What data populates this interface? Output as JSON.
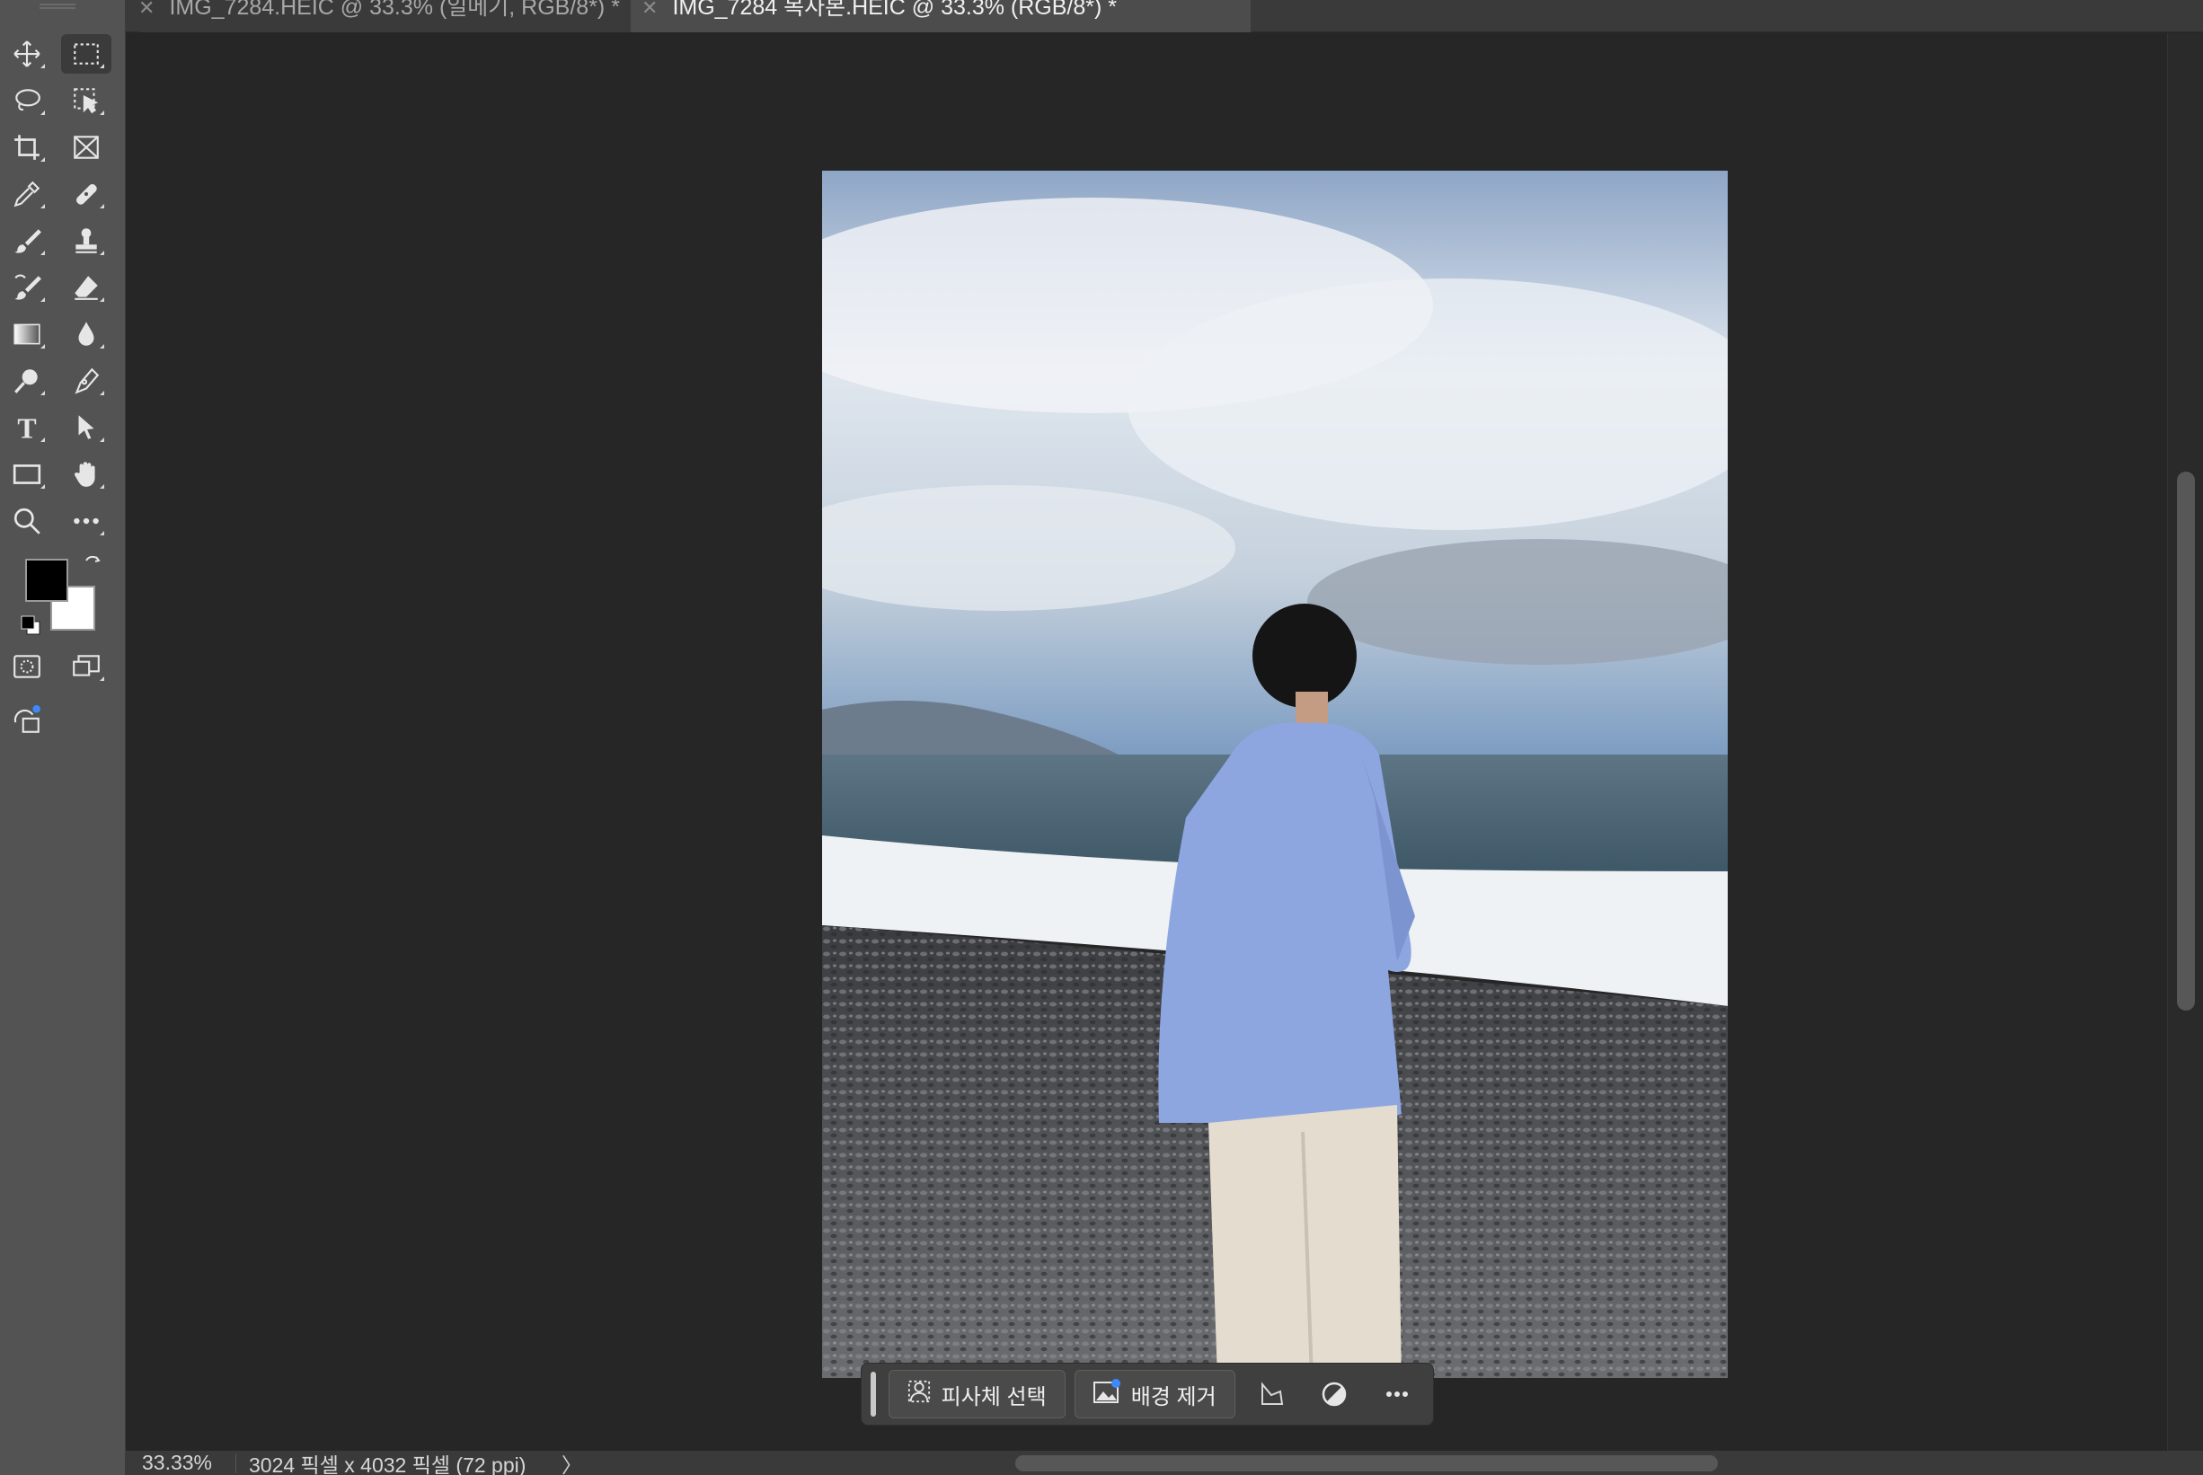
{
  "tabs": [
    {
      "label": "IMG_7284.HEIC @ 33.3% (일메기, RGB/8*) *",
      "active": false
    },
    {
      "label": "IMG_7284 복사본.HEIC @ 33.3% (RGB/8*) *",
      "active": true
    }
  ],
  "toolbar": {
    "tools": [
      {
        "name": "move-tool-icon"
      },
      {
        "name": "rectangular-marquee-tool-icon"
      },
      {
        "name": "lasso-tool-icon"
      },
      {
        "name": "object-selection-tool-icon"
      },
      {
        "name": "crop-tool-icon"
      },
      {
        "name": "frame-tool-icon"
      },
      {
        "name": "eyedropper-tool-icon"
      },
      {
        "name": "healing-brush-tool-icon"
      },
      {
        "name": "brush-tool-icon"
      },
      {
        "name": "clone-stamp-tool-icon"
      },
      {
        "name": "history-brush-tool-icon"
      },
      {
        "name": "eraser-tool-icon"
      },
      {
        "name": "gradient-tool-icon"
      },
      {
        "name": "blur-tool-icon"
      },
      {
        "name": "dodge-tool-icon"
      },
      {
        "name": "pen-tool-icon"
      },
      {
        "name": "type-tool-icon"
      },
      {
        "name": "path-selection-tool-icon"
      },
      {
        "name": "rectangle-tool-icon"
      },
      {
        "name": "hand-tool-icon"
      },
      {
        "name": "zoom-tool-icon"
      },
      {
        "name": "more-tools-icon"
      }
    ],
    "foreground_color": "#000000",
    "background_color": "#ffffff"
  },
  "taskbar": {
    "select_subject": "피사체 선택",
    "remove_background": "배경 제거"
  },
  "status": {
    "zoom": "33.33%",
    "doc_info": "3024 픽셀 x 4032 픽셀 (72 ppi)",
    "arrow": "〉"
  },
  "colors": {
    "panel": "#535353",
    "canvas": "#262626",
    "tab_active": "#4c4c4c"
  }
}
